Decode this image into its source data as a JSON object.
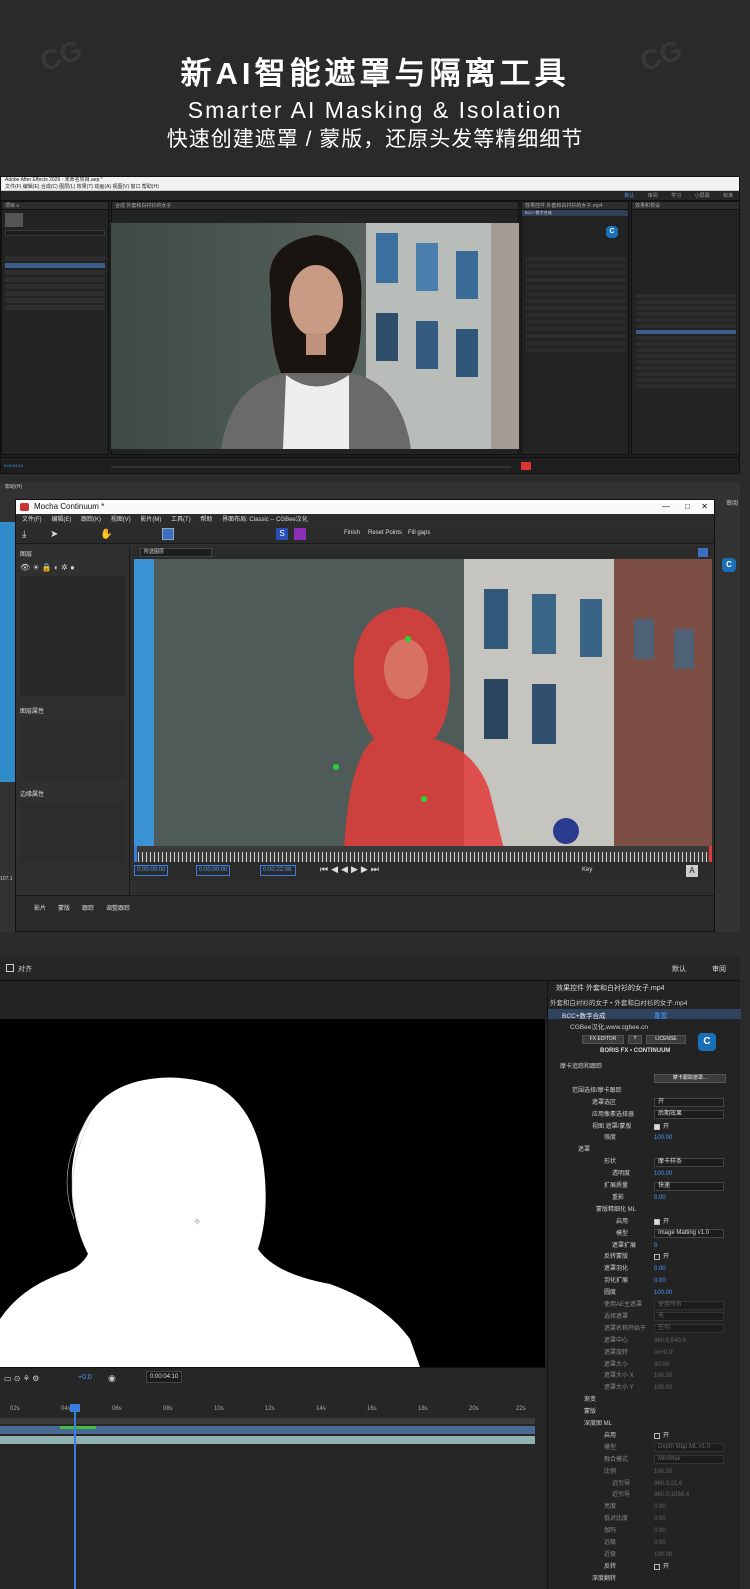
{
  "hero": {
    "title": "新AI智能遮罩与隔离工具",
    "subtitle_en": "Smarter AI Masking & Isolation",
    "subtitle_cn": "快速创建遮罩 / 蒙版，还原头发等精细细节"
  },
  "ae_top": {
    "app_title": "Adobe After Effects 2026 - 未命名项目.aep *",
    "menu": "文件(F)  编辑(E)  合成(C)  图层(L)  效果(T)  动画(A)  视图(V)  窗口  帮助(H)",
    "workspace_tabs": [
      "默认",
      "审阅",
      "学习",
      "小屏幕",
      "标准"
    ],
    "project_label": "项目 ≡",
    "comp_tab": "合成 外套和白衬衫的女子",
    "effect_tab": "效果控件 外套和白衬衫的女子.mp4",
    "plugin_name": "BCC+数字合成",
    "effects_tab": "效果和预设",
    "timeline_time": "0:00:04:10"
  },
  "mocha": {
    "window_title": "Mocha Continuum *",
    "menu": [
      "文件(F)",
      "编辑(E)",
      "跟踪(K)",
      "视图(V)",
      "影片(M)",
      "工具(T)",
      "帮助",
      "界面布局: Classic -- CGBee汉化"
    ],
    "tool_labels": [
      "Finish",
      "Reset Points",
      "Fill gaps"
    ],
    "layers_label": "图层",
    "layer_props_label": "图层属性",
    "edge_props_label": "边缘属性",
    "view_select": "所选图层",
    "time_start": "0:00:00:00",
    "time_current": "0:00:00:00",
    "time_end": "0:00:22:08",
    "key_label": "Key",
    "bottom_tabs": [
      "影片",
      "蒙版",
      "跟踪",
      "调整跟踪"
    ],
    "left_edge_label": "帮助(H)",
    "right_edge_label": "审阅",
    "frame_label": "107.1"
  },
  "ae_bottom": {
    "workspace": [
      "默认",
      "审阅"
    ],
    "align_label": "对齐",
    "effect_panel_title": "效果控件 外套和白衬衫的女子.mp4",
    "layer_path": "外套和白衬衫的女子 • 外套和白衬衫的女子.mp4",
    "plugin": "BCC+数字合成",
    "reset": "重置",
    "cgbee": "CGBee汉化,www.cgbee.cn",
    "fx_editor": "FX EDITOR",
    "help_q": "?",
    "license": "LICENSE",
    "boris": "BORIS FX • CONTINUUM",
    "rows": [
      {
        "label": "摩卡追踪和跟踪",
        "indent": 12
      },
      {
        "label": "摩卡跟踪遮罩...",
        "indent": 30,
        "button": "摩卡跟踪遮罩..."
      },
      {
        "label": "范围选择/摩卡跟踪",
        "indent": 24
      },
      {
        "label": "遮罩选区",
        "indent": 44,
        "dropdown": "开"
      },
      {
        "label": "应用像素选择器",
        "indent": 44,
        "dropdown": "后期效果"
      },
      {
        "label": "视图 遮罩/蒙版",
        "indent": 44,
        "check": "开"
      },
      {
        "label": "强度",
        "indent": 56,
        "value": "100.00"
      },
      {
        "label": "遮罩",
        "indent": 30
      },
      {
        "label": "形状",
        "indent": 56,
        "dropdown": "摩卡样条"
      },
      {
        "label": "透明度",
        "indent": 64,
        "value": "100.00"
      },
      {
        "label": "扩展质量",
        "indent": 56,
        "dropdown": "快速"
      },
      {
        "label": "重影",
        "indent": 64,
        "value": "0.00"
      },
      {
        "label": "蒙版精细化 ML",
        "indent": 48
      },
      {
        "label": "启用",
        "indent": 68,
        "check": "开"
      },
      {
        "label": "模型",
        "indent": 68,
        "dropdown": "Image Matting v1.0"
      },
      {
        "label": "遮罩扩展",
        "indent": 64,
        "value": "0"
      },
      {
        "label": "反转蒙版",
        "indent": 56,
        "check_off": "开"
      },
      {
        "label": "遮罩羽化",
        "indent": 56,
        "value": "0.00"
      },
      {
        "label": "羽化扩展",
        "indent": 56,
        "value": "0.00"
      },
      {
        "label": "圆度",
        "indent": 56,
        "value": "100.00"
      },
      {
        "label": "使用AE主遮罩",
        "indent": 56,
        "dim_dropdown": "使用所有"
      },
      {
        "label": "选择遮罩",
        "indent": 56,
        "dim_dropdown": "无"
      },
      {
        "label": "遮罩名称开始于",
        "indent": 56,
        "dim_dropdown": "任何"
      },
      {
        "label": "遮罩中心",
        "indent": 56,
        "dim_value": "960.0,540.0"
      },
      {
        "label": "遮罩旋转",
        "indent": 56,
        "dim_value": "0x+0.0°"
      },
      {
        "label": "遮罩大小",
        "indent": 56,
        "dim_value": "90.00"
      },
      {
        "label": "遮罩大小 X",
        "indent": 56,
        "dim_value": "100.00"
      },
      {
        "label": "遮罩大小 Y",
        "indent": 56,
        "dim_value": "100.00"
      },
      {
        "label": "渐变",
        "indent": 36
      },
      {
        "label": "蒙版",
        "indent": 36
      },
      {
        "label": "深度图 ML",
        "indent": 36
      },
      {
        "label": "启用",
        "indent": 56,
        "check_off": "开"
      },
      {
        "label": "模型",
        "indent": 56,
        "dim_dropdown": "Depth Map ML v1.0"
      },
      {
        "label": "融合模式",
        "indent": 56,
        "dim_dropdown": "Min/Max"
      },
      {
        "label": "比例",
        "indent": 56,
        "dim_value": "100.00"
      },
      {
        "label": "远引导",
        "indent": 64,
        "dim_value": "960.0,21.6"
      },
      {
        "label": "近引导",
        "indent": 64,
        "dim_value": "960.0,1058.4"
      },
      {
        "label": "亮度",
        "indent": 56,
        "dim_value": "0.00"
      },
      {
        "label": "低对比度",
        "indent": 56,
        "dim_value": "0.00"
      },
      {
        "label": "伽玛",
        "indent": 56,
        "dim_value": "0.00"
      },
      {
        "label": "远极",
        "indent": 56,
        "dim_value": "0.00"
      },
      {
        "label": "近极",
        "indent": 56,
        "dim_value": "100.00"
      },
      {
        "label": "反转",
        "indent": 56,
        "check_off": "开"
      },
      {
        "label": "深度翻转",
        "indent": 44
      }
    ],
    "timecode": "0:00:04:10",
    "offset": "+0.0",
    "ruler": [
      "02s",
      "04s",
      "06s",
      "08s",
      "10s",
      "12s",
      "14s",
      "16s",
      "18s",
      "20s",
      "22s"
    ]
  }
}
